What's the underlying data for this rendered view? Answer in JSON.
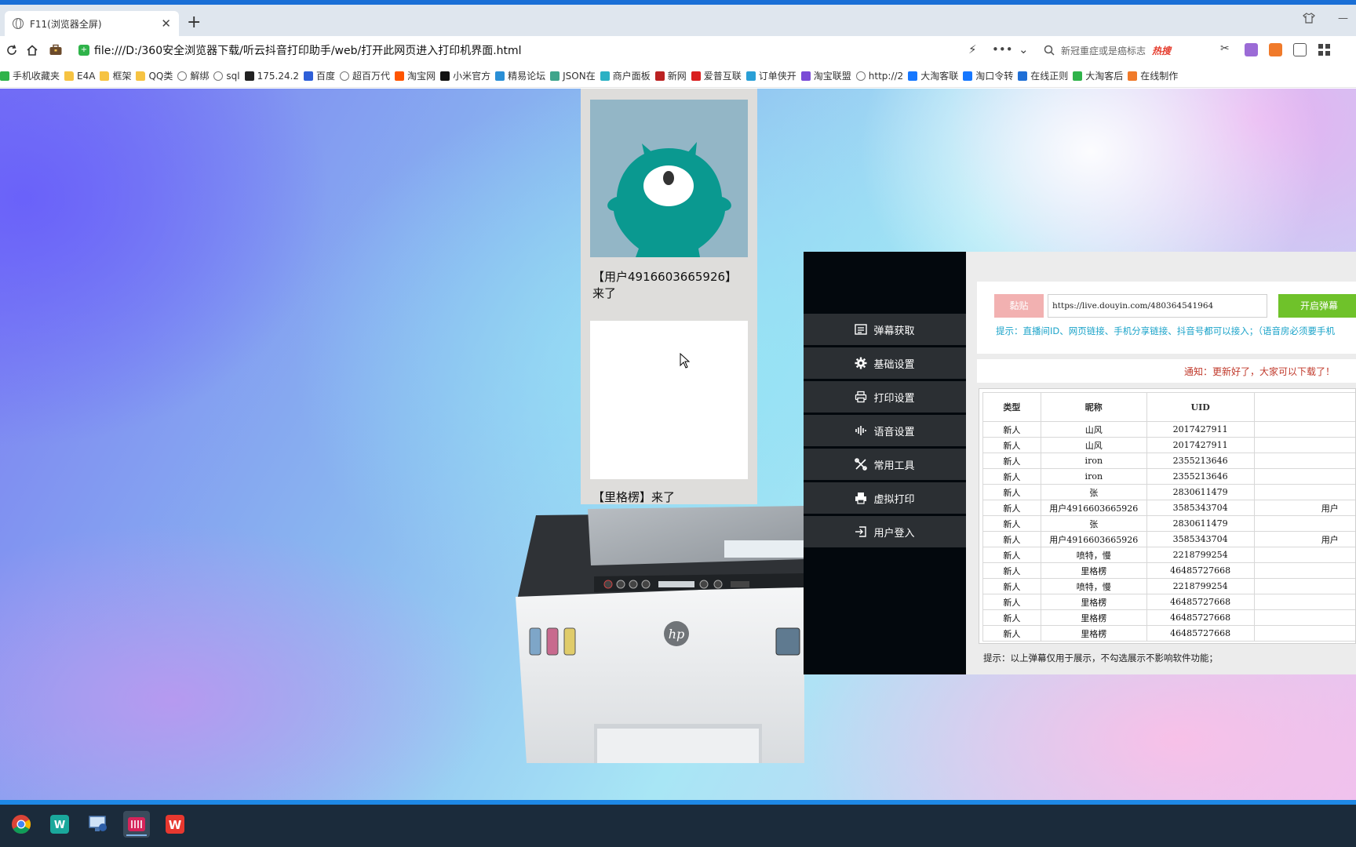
{
  "browser": {
    "tab_title": "F11(浏览器全屏)",
    "address": "file:///D:/360安全浏览器下载/听云抖音打印助手/web/打开此网页进入打印机界面.html",
    "search_placeholder": "新冠重症或是癌标志",
    "search_badge": "热搜",
    "bookmarks": [
      {
        "label": "手机收藏夹",
        "icon": "phone-icon"
      },
      {
        "label": "E4A",
        "icon": "folder-icon"
      },
      {
        "label": "框架",
        "icon": "folder-icon"
      },
      {
        "label": "QQ类",
        "icon": "folder-icon"
      },
      {
        "label": "解绑",
        "icon": "globe-icon"
      },
      {
        "label": "sql",
        "icon": "globe-icon"
      },
      {
        "label": "175.24.2",
        "icon": "site-icon"
      },
      {
        "label": "百度",
        "icon": "baidu-icon"
      },
      {
        "label": "超百万代",
        "icon": "globe-icon"
      },
      {
        "label": "淘宝网",
        "icon": "taobao-icon"
      },
      {
        "label": "小米官方",
        "icon": "tiktok-icon"
      },
      {
        "label": "精易论坛",
        "icon": "eye-icon"
      },
      {
        "label": "JSON在",
        "icon": "gear-icon"
      },
      {
        "label": "商户面板",
        "icon": "shop-icon"
      },
      {
        "label": "新网",
        "icon": "xinnet-icon"
      },
      {
        "label": "爱普互联",
        "icon": "a-icon"
      },
      {
        "label": "订单侠开",
        "icon": "cloud-icon"
      },
      {
        "label": "淘宝联盟",
        "icon": "alliance-icon"
      },
      {
        "label": "http://2",
        "icon": "globe-icon"
      },
      {
        "label": "大淘客联",
        "icon": "dataoke-icon"
      },
      {
        "label": "淘口令转",
        "icon": "dataoke-icon"
      },
      {
        "label": "在线正则",
        "icon": "c-icon"
      },
      {
        "label": "大淘客后",
        "icon": "leaf-icon"
      },
      {
        "label": "在线制作",
        "icon": "g-icon"
      }
    ]
  },
  "barrage": {
    "msg1": "【用户4916603665926】来了",
    "msg2": "【里格楞】来了"
  },
  "menu": [
    {
      "label": "弹幕获取",
      "icon": "list-icon"
    },
    {
      "label": "基础设置",
      "icon": "gear-icon"
    },
    {
      "label": "打印设置",
      "icon": "printer-icon"
    },
    {
      "label": "语音设置",
      "icon": "voice-icon"
    },
    {
      "label": "常用工具",
      "icon": "tools-icon"
    },
    {
      "label": "虚拟打印",
      "icon": "virtual-print-icon"
    },
    {
      "label": "用户登入",
      "icon": "login-icon"
    }
  ],
  "panel": {
    "paste_label": "黏贴",
    "url_value": "https://live.douyin.com/480364541964",
    "start_label": "开启弹幕",
    "tip": "提示：直播间ID、网页链接、手机分享链接、抖音号都可以接入；（语音房必须要手机",
    "notice": "通知：更新好了，大家可以下载了！",
    "footer_tip": "提示：以上弹幕仅用于展示，不勾选展示不影响软件功能；"
  },
  "table": {
    "headers": [
      "类型",
      "昵称",
      "UID",
      ""
    ],
    "rows": [
      [
        "新人",
        "山风",
        "2017427911",
        ""
      ],
      [
        "新人",
        "山风",
        "2017427911",
        ""
      ],
      [
        "新人",
        "iron",
        "2355213646",
        ""
      ],
      [
        "新人",
        "iron",
        "2355213646",
        ""
      ],
      [
        "新人",
        "张",
        "2830611479",
        ""
      ],
      [
        "新人",
        "用户4916603665926",
        "3585343704",
        "用户"
      ],
      [
        "新人",
        "张",
        "2830611479",
        ""
      ],
      [
        "新人",
        "用户4916603665926",
        "3585343704",
        "用户"
      ],
      [
        "新人",
        "喷特，慢",
        "2218799254",
        ""
      ],
      [
        "新人",
        "里格楞",
        "46485727668",
        ""
      ],
      [
        "新人",
        "喷特，慢",
        "2218799254",
        ""
      ],
      [
        "新人",
        "里格楞",
        "46485727668",
        ""
      ],
      [
        "新人",
        "里格楞",
        "46485727668",
        ""
      ],
      [
        "新人",
        "里格楞",
        "46485727668",
        ""
      ]
    ]
  },
  "taskbar": [
    {
      "app": "chrome-icon"
    },
    {
      "app": "wps-writer-icon"
    },
    {
      "app": "remote-desktop-icon"
    },
    {
      "app": "barcode-tool-icon"
    },
    {
      "app": "wps-office-icon"
    }
  ],
  "colors": {
    "sidebar_bg": "#03080d",
    "menu_bg": "#2b2f33",
    "start_green": "#6fc22a",
    "paste_pink": "#f2b1b1",
    "tip_cyan": "#1aa3c9",
    "notice_red": "#c0392b"
  }
}
